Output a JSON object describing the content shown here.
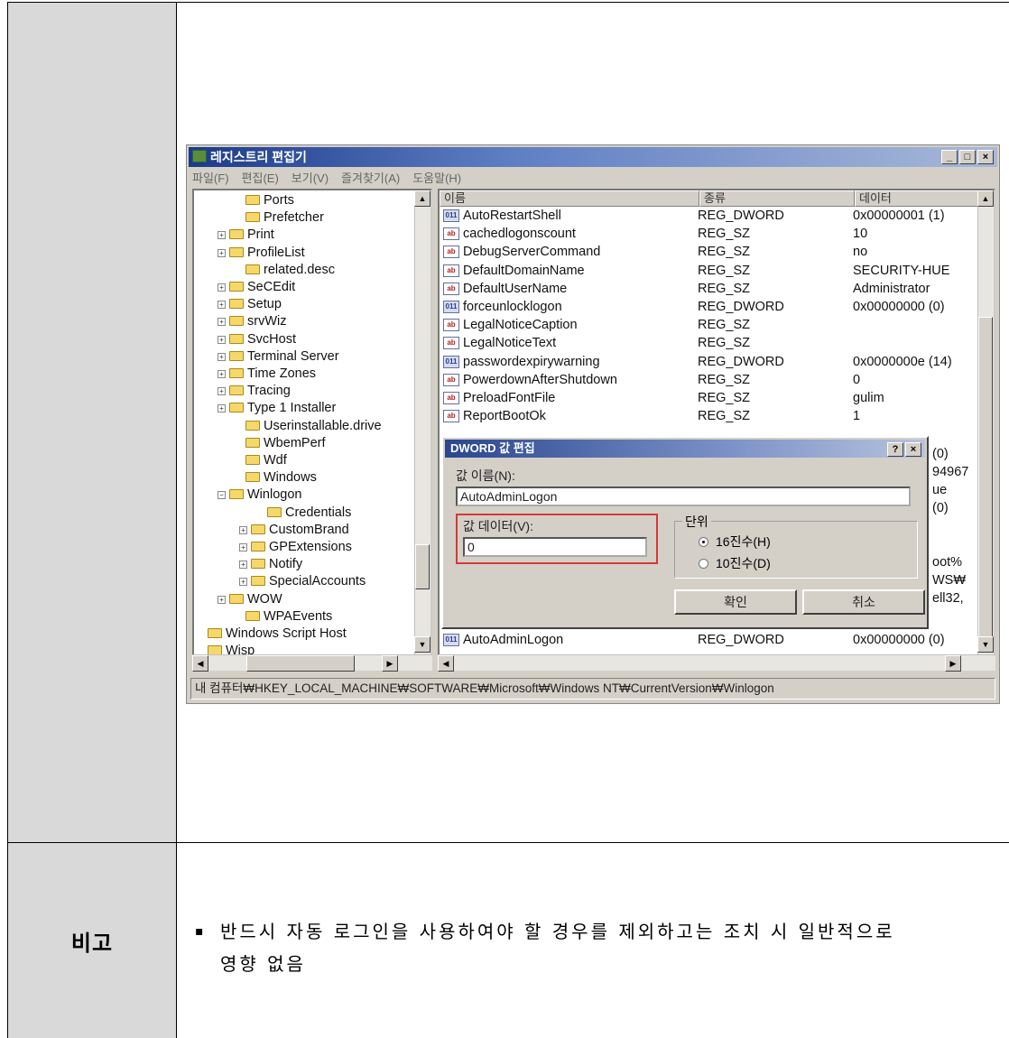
{
  "remark": {
    "label": "비고",
    "bullet": "▪",
    "note_line1": "반드시 자동 로그인을 사용하여야 할 경우를 제외하고는 조치 시 일반적으로",
    "note_line2": "영향 없음"
  },
  "regedit": {
    "title": "레지스트리 편집기",
    "window_buttons": [
      "_",
      "□",
      "×"
    ],
    "menu": [
      "파일(F)",
      "편집(E)",
      "보기(V)",
      "즐겨찾기(A)",
      "도움말(H)"
    ],
    "tree_items": [
      {
        "label": "Ports",
        "expander": ""
      },
      {
        "label": "Prefetcher",
        "expander": ""
      },
      {
        "label": "Print",
        "expander": "+"
      },
      {
        "label": "ProfileList",
        "expander": "+"
      },
      {
        "label": "related.desc",
        "expander": ""
      },
      {
        "label": "SeCEdit",
        "expander": "+"
      },
      {
        "label": "Setup",
        "expander": "+"
      },
      {
        "label": "srvWiz",
        "expander": "+"
      },
      {
        "label": "SvcHost",
        "expander": "+"
      },
      {
        "label": "Terminal Server",
        "expander": "+"
      },
      {
        "label": "Time Zones",
        "expander": "+"
      },
      {
        "label": "Tracing",
        "expander": "+"
      },
      {
        "label": "Type 1 Installer",
        "expander": "+"
      },
      {
        "label": "Userinstallable.drive",
        "expander": ""
      },
      {
        "label": "WbemPerf",
        "expander": ""
      },
      {
        "label": "Wdf",
        "expander": ""
      },
      {
        "label": "Windows",
        "expander": ""
      },
      {
        "label": "Winlogon",
        "expander": "−"
      },
      {
        "label": "Credentials",
        "expander": ""
      },
      {
        "label": "CustomBrand",
        "expander": "+"
      },
      {
        "label": "GPExtensions",
        "expander": "+"
      },
      {
        "label": "Notify",
        "expander": "+"
      },
      {
        "label": "SpecialAccounts",
        "expander": "+"
      },
      {
        "label": "WOW",
        "expander": "+"
      },
      {
        "label": "WPAEvents",
        "expander": ""
      },
      {
        "label": "Windows Script Host",
        "expander": ""
      },
      {
        "label": "Wisp",
        "expander": ""
      }
    ],
    "columns": [
      "이름",
      "종류",
      "데이터"
    ],
    "values": [
      {
        "name": "AutoRestartShell",
        "type": "REG_DWORD",
        "data": "0x00000001 (1)",
        "icon": "dword"
      },
      {
        "name": "cachedlogonscount",
        "type": "REG_SZ",
        "data": "10",
        "icon": "sz"
      },
      {
        "name": "DebugServerCommand",
        "type": "REG_SZ",
        "data": "no",
        "icon": "sz"
      },
      {
        "name": "DefaultDomainName",
        "type": "REG_SZ",
        "data": "SECURITY-HUE",
        "icon": "sz"
      },
      {
        "name": "DefaultUserName",
        "type": "REG_SZ",
        "data": "Administrator",
        "icon": "sz"
      },
      {
        "name": "forceunlocklogon",
        "type": "REG_DWORD",
        "data": "0x00000000 (0)",
        "icon": "dword"
      },
      {
        "name": "LegalNoticeCaption",
        "type": "REG_SZ",
        "data": "",
        "icon": "sz"
      },
      {
        "name": "LegalNoticeText",
        "type": "REG_SZ",
        "data": "",
        "icon": "sz"
      },
      {
        "name": "passwordexpirywarning",
        "type": "REG_DWORD",
        "data": "0x0000000e (14)",
        "icon": "dword"
      },
      {
        "name": "PowerdownAfterShutdown",
        "type": "REG_SZ",
        "data": "0",
        "icon": "sz"
      },
      {
        "name": "PreloadFontFile",
        "type": "REG_SZ",
        "data": "gulim",
        "icon": "sz"
      },
      {
        "name": "ReportBootOk",
        "type": "REG_SZ",
        "data": "1",
        "icon": "sz"
      }
    ],
    "hidden_data_fragments": [
      "(0)",
      "94967",
      "ue",
      "(0)",
      "oot%",
      "WS₩",
      "ell32,"
    ],
    "last_value": {
      "name": "AutoAdminLogon",
      "type": "REG_DWORD",
      "data": "0x00000000 (0)",
      "icon": "dword"
    },
    "status": "내 컴퓨터₩HKEY_LOCAL_MACHINE₩SOFTWARE₩Microsoft₩Windows NT₩CurrentVersion₩Winlogon"
  },
  "dialog": {
    "title": "DWORD 값 편집",
    "help_btn": "?",
    "close_btn": "×",
    "value_name_label": "값 이름(N):",
    "value_name": "AutoAdminLogon",
    "value_data_label": "값 데이터(V):",
    "value_data": "0",
    "unit_label": "단위",
    "hex_label": "16진수(H)",
    "dec_label": "10진수(D)",
    "ok_label": "확인",
    "cancel_label": "취소",
    "highlight_color": "#d63838"
  }
}
